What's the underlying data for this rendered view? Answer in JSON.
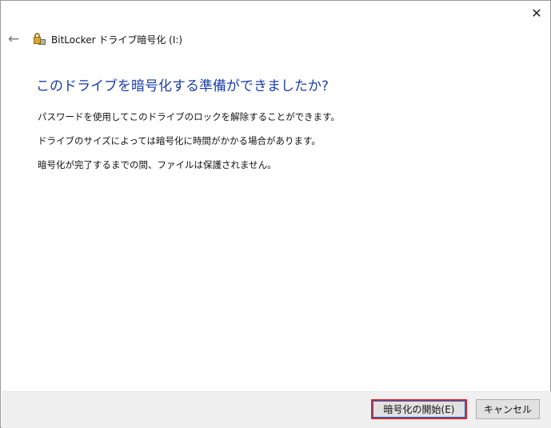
{
  "window": {
    "close_glyph": "✕",
    "back_glyph": "←",
    "title": "BitLocker ドライブ暗号化 (I:)"
  },
  "main": {
    "heading": "このドライブを暗号化する準備ができましたか?",
    "paragraphs": [
      "パスワードを使用してこのドライブのロックを解除することができます。",
      "ドライブのサイズによっては暗号化に時間がかかる場合があります。",
      "暗号化が完了するまでの間、ファイルは保護されません。"
    ]
  },
  "footer": {
    "start_label": "暗号化の開始(E)",
    "cancel_label": "キャンセル"
  }
}
